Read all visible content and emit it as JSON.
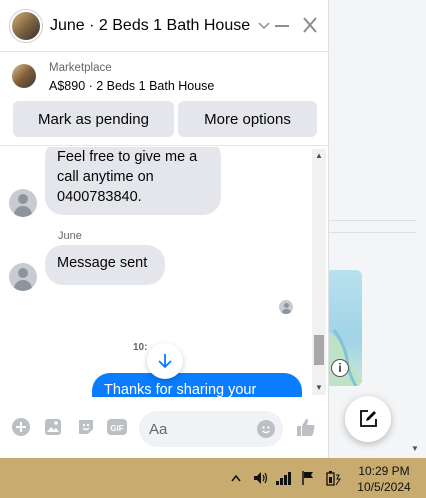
{
  "chat": {
    "title": "June · 2 Beds 1 Bath House",
    "minimize_icon": "minus-icon",
    "close_icon": "close-icon"
  },
  "marketplace": {
    "category": "Marketplace",
    "listing": "A$890 · 2 Beds 1 Bath House",
    "mark_pending_label": "Mark as pending",
    "more_options_label": "More options"
  },
  "messages": {
    "first_line1": "Feel free to give me a",
    "first_line2": "call anytime on",
    "first_line3": "0400783840.",
    "sender_name": "June",
    "second": "Message sent",
    "time_partial": "10:",
    "outgoing": "Thanks for sharing your"
  },
  "composer": {
    "placeholder": "Aa"
  },
  "taskbar": {
    "time": "10:29 PM",
    "date": "10/5/2024"
  },
  "colors": {
    "accent": "#0a7cff",
    "taskbar": "#c8ab6e",
    "bubble_in": "#e4e6eb"
  }
}
